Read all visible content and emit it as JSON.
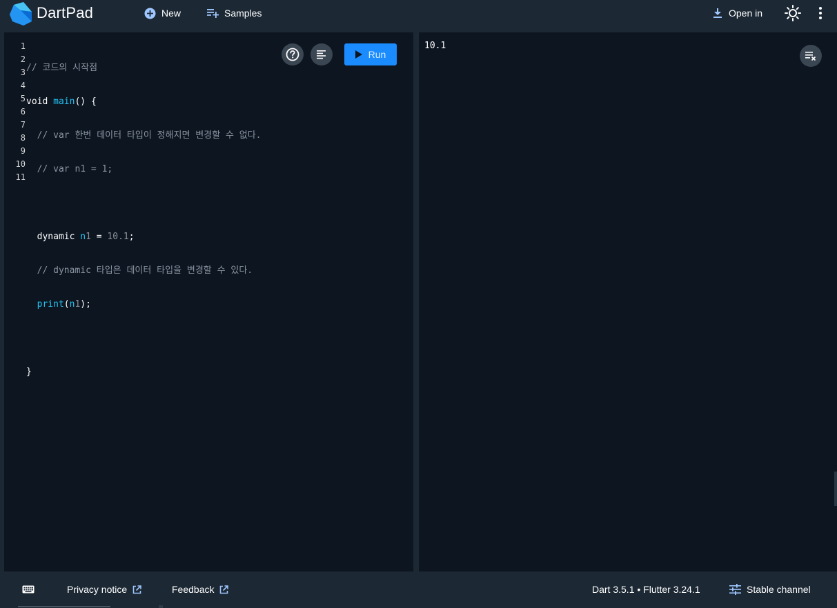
{
  "app": {
    "title": "DartPad"
  },
  "toolbar": {
    "new_label": "New",
    "samples_label": "Samples",
    "open_in_label": "Open in"
  },
  "editor": {
    "line_numbers": [
      "1",
      "2",
      "3",
      "4",
      "5",
      "6",
      "7",
      "8",
      "9",
      "10",
      "11"
    ],
    "lines": [
      "// 코드의 시작점",
      "void main() {",
      "  // var 한번 데이터 타입이 정해지면 변경할 수 없다.",
      "  // var n1 = 1;",
      "",
      "  dynamic n1 = 10.1;",
      "  // dynamic 타입은 데이터 타입을 변경할 수 있다.",
      "  print(n1);",
      "",
      "}",
      ""
    ],
    "run_label": "Run"
  },
  "output": {
    "text": "10.1"
  },
  "footer": {
    "privacy_label": "Privacy notice",
    "feedback_label": "Feedback",
    "version_label": "Dart 3.5.1 • Flutter 3.24.1",
    "channel_label": "Stable channel"
  },
  "colors": {
    "background": "#1c2834",
    "pane": "#0d1520",
    "run_button": "#1a8cff",
    "accent_code": "#23c2f2",
    "circle_button": "#3b4653"
  },
  "icons": {
    "logo": "dart-logo",
    "new": "add-circle-icon",
    "samples": "playlist-add-icon",
    "open_in": "download-icon",
    "theme": "sun-icon",
    "more": "more-vert-icon",
    "help": "help-icon",
    "format": "format-icon",
    "run": "play-icon",
    "clear": "clear-output-icon",
    "keyboard": "keyboard-icon",
    "external": "external-link-icon",
    "channel": "tune-icon"
  }
}
